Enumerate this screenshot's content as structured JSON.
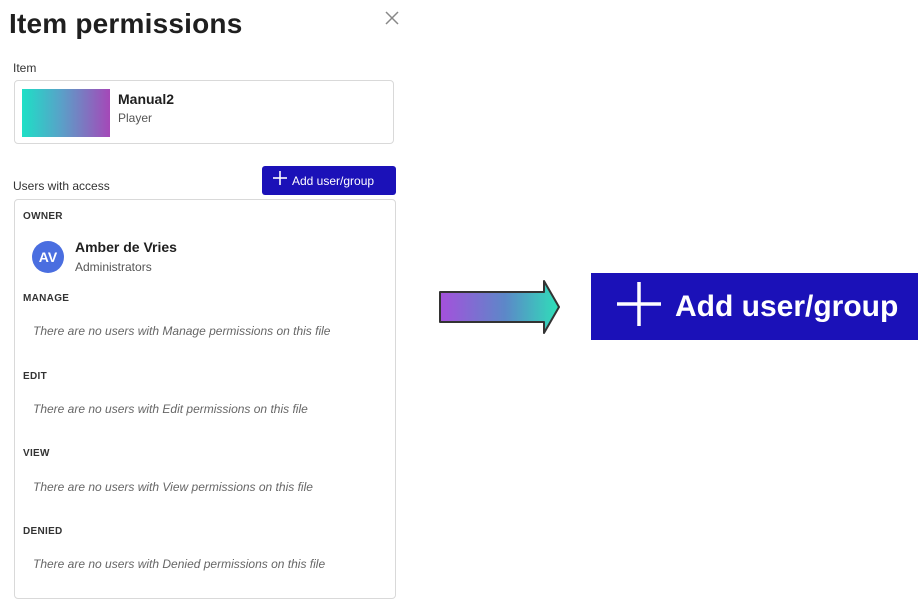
{
  "dialog": {
    "title": "Item permissions",
    "item_label": "Item",
    "item": {
      "name": "Manual2",
      "type": "Player"
    },
    "users_label": "Users with access",
    "add_button_label": "Add user/group",
    "groups": {
      "owner": {
        "heading": "OWNER",
        "user": {
          "initials": "AV",
          "name": "Amber de Vries",
          "role": "Administrators"
        }
      },
      "manage": {
        "heading": "MANAGE",
        "empty": "There are no users with Manage permissions on this file"
      },
      "edit": {
        "heading": "EDIT",
        "empty": "There are no users with Edit permissions on this file"
      },
      "view": {
        "heading": "VIEW",
        "empty": "There are no users with View permissions on this file"
      },
      "denied": {
        "heading": "DENIED",
        "empty": "There are no users with Denied permissions on this file"
      }
    }
  },
  "callout": {
    "button_label": "Add user/group"
  },
  "icons": {
    "close": "close-icon",
    "plus": "plus-icon",
    "arrow": "arrow-right-icon"
  },
  "colors": {
    "accent": "#1b11b8",
    "avatar": "#4a6ee0"
  }
}
